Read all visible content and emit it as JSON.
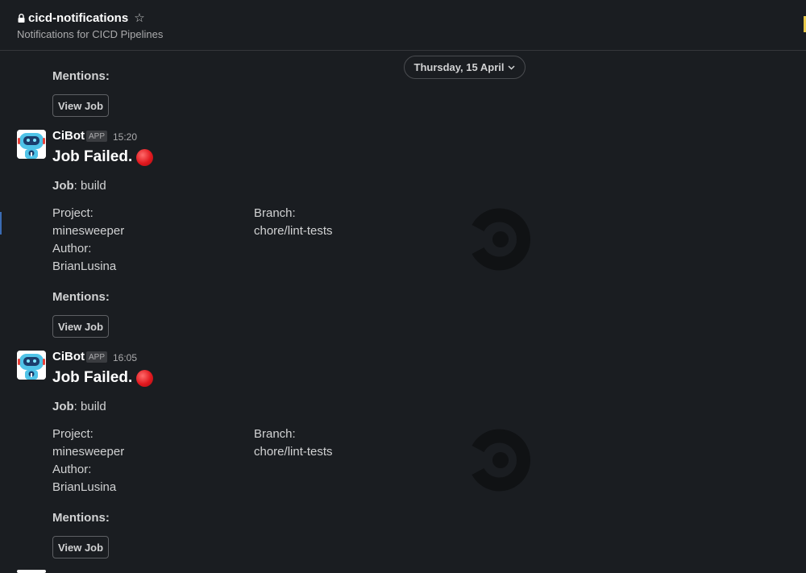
{
  "header": {
    "channel_name": "cicd-notifications",
    "topic": "Notifications for CICD Pipelines",
    "lock_icon": "lock-icon",
    "star_icon": "star-icon"
  },
  "date_divider": {
    "label": "Thursday, 15 April"
  },
  "previous_message": {
    "mentions_label": "Mentions:",
    "button_label": "View Job"
  },
  "messages": [
    {
      "bot_name": "CiBot",
      "badge": "APP",
      "time": "15:20",
      "title": "Job Failed.",
      "job_label": "Job",
      "job_value": ": build",
      "project_label": "Project:",
      "project_value": "minesweeper",
      "branch_label": "Branch:",
      "branch_value": "chore/lint-tests",
      "author_label": "Author:",
      "author_value": "BrianLusina",
      "mentions_label": "Mentions:",
      "button_label": "View Job"
    },
    {
      "bot_name": "CiBot",
      "badge": "APP",
      "time": "16:05",
      "title": "Job Failed.",
      "job_label": "Job",
      "job_value": ": build",
      "project_label": "Project:",
      "project_value": "minesweeper",
      "branch_label": "Branch:",
      "branch_value": "chore/lint-tests",
      "author_label": "Author:",
      "author_value": "BrianLusina",
      "mentions_label": "Mentions:",
      "button_label": "View Job"
    }
  ],
  "colors": {
    "background": "#1a1d21",
    "text": "#d1d2d3",
    "failure_dot": "#e0181e"
  }
}
